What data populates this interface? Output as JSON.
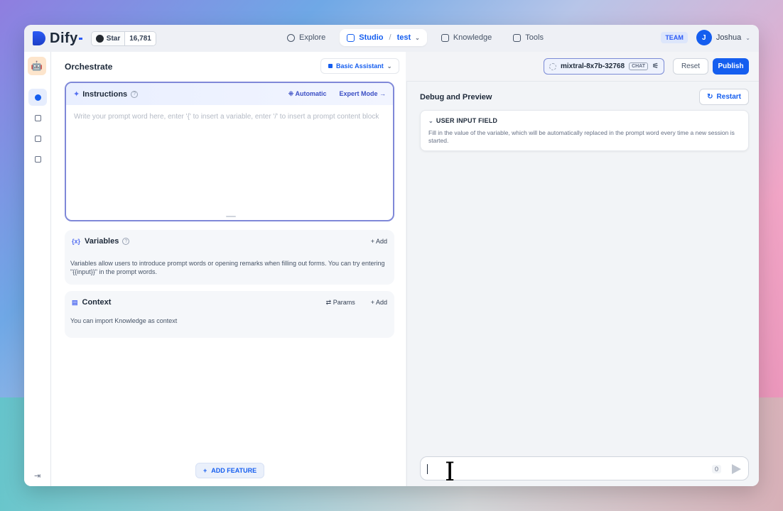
{
  "brand": {
    "name": "Dify",
    "accent": "#155eef"
  },
  "github": {
    "star_label": "Star",
    "count": "16,781"
  },
  "nav": {
    "explore": "Explore",
    "studio": "Studio",
    "app_name": "test",
    "knowledge": "Knowledge",
    "tools": "Tools"
  },
  "account": {
    "team": "TEAM",
    "initial": "J",
    "name": "Joshua"
  },
  "orchestrate": {
    "title": "Orchestrate",
    "mode": "Basic Assistant",
    "instructions": {
      "title": "Instructions",
      "automatic": "Automatic",
      "expert_mode": "Expert Mode",
      "placeholder": "Write your prompt word here, enter '{' to insert a variable, enter '/' to insert a prompt content block"
    },
    "variables": {
      "title": "Variables",
      "add": "Add",
      "description": "Variables allow users to introduce prompt words or opening remarks when filling out forms. You can try entering \"{{input}}\" in the prompt words."
    },
    "context": {
      "title": "Context",
      "params": "Params",
      "add": "Add",
      "description": "You can import Knowledge as context"
    },
    "add_feature": "ADD FEATURE"
  },
  "toolbar": {
    "model": "mixtral-8x7b-32768",
    "model_badge": "CHAT",
    "reset": "Reset",
    "publish": "Publish"
  },
  "debug": {
    "title": "Debug and Preview",
    "restart": "Restart",
    "user_input": {
      "title": "USER INPUT FIELD",
      "description": "Fill in the value of the variable, which will be automatically replaced in the prompt word every time a new session is started."
    },
    "char_count": "0"
  }
}
